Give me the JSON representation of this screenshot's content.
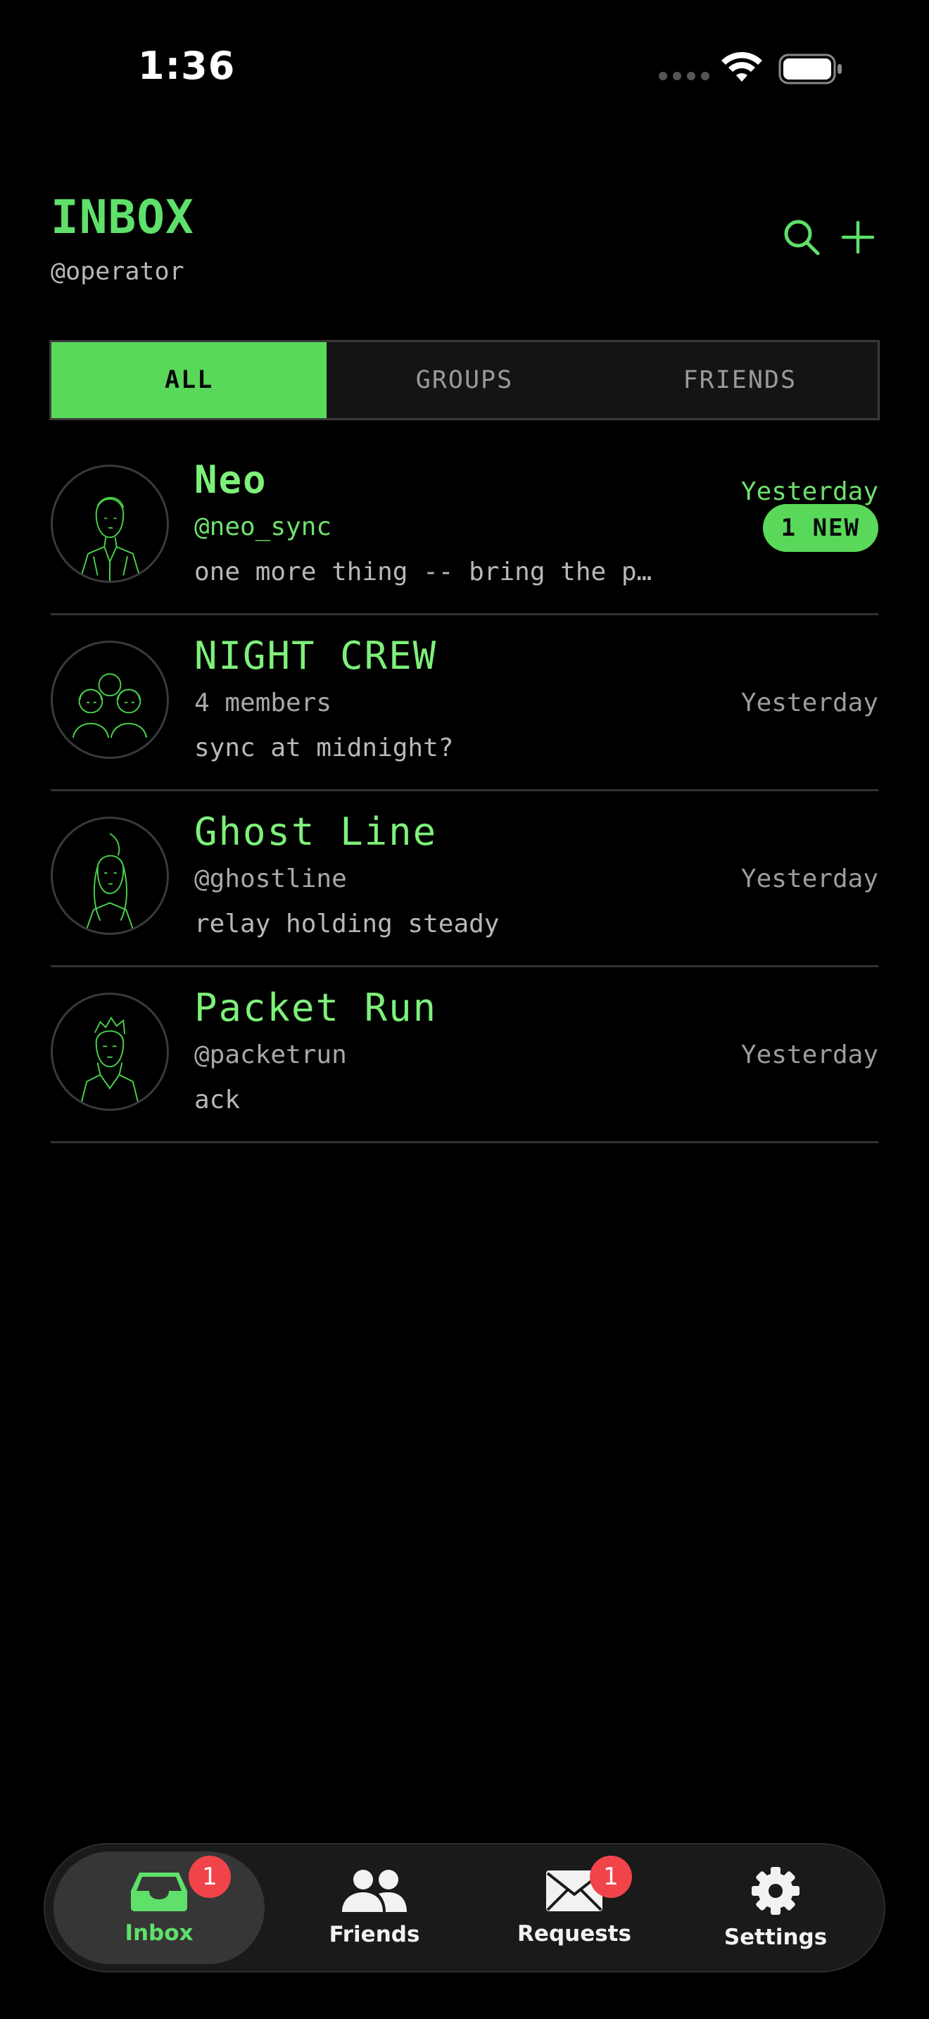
{
  "status_bar": {
    "time": "1:36"
  },
  "header": {
    "title": "INBOX",
    "handle": "@operator",
    "search_icon": "search-icon",
    "add_icon": "plus-icon"
  },
  "filter_tabs": [
    {
      "label": "ALL",
      "active": true
    },
    {
      "label": "GROUPS",
      "active": false
    },
    {
      "label": "FRIENDS",
      "active": false
    }
  ],
  "conversations": [
    {
      "name": "Neo",
      "subtitle": "@neo_sync",
      "preview": "one more thing -- bring the p…",
      "time": "Yesterday",
      "badge": "1 NEW",
      "unread": true
    },
    {
      "name": "NIGHT CREW",
      "subtitle": "4 members",
      "preview": "sync at midnight?",
      "time": "Yesterday",
      "badge": null,
      "unread": false
    },
    {
      "name": "Ghost Line",
      "subtitle": "@ghostline",
      "preview": "relay holding steady",
      "time": "Yesterday",
      "badge": null,
      "unread": false
    },
    {
      "name": "Packet Run",
      "subtitle": "@packetrun",
      "preview": "ack",
      "time": "Yesterday",
      "badge": null,
      "unread": false
    }
  ],
  "tab_bar": {
    "items": [
      {
        "label": "Inbox",
        "icon": "inbox-tray-icon",
        "badge": "1",
        "active": true
      },
      {
        "label": "Friends",
        "icon": "people-icon",
        "badge": null,
        "active": false
      },
      {
        "label": "Requests",
        "icon": "envelope-icon",
        "badge": "1",
        "active": false
      },
      {
        "label": "Settings",
        "icon": "gear-icon",
        "badge": null,
        "active": false
      }
    ]
  },
  "colors": {
    "accent": "#5ad85a",
    "background": "#000000",
    "badge_red": "#f0444a"
  }
}
